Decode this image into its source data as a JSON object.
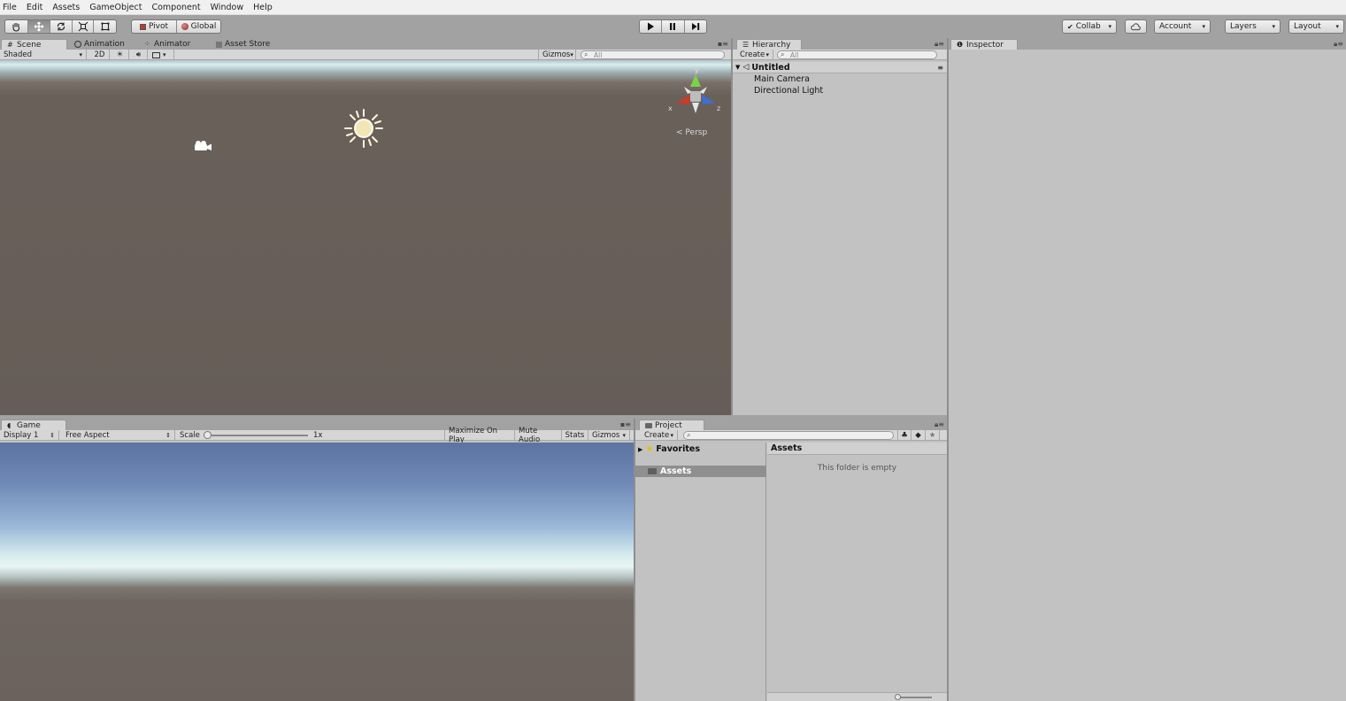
{
  "menu": [
    "File",
    "Edit",
    "Assets",
    "GameObject",
    "Component",
    "Window",
    "Help"
  ],
  "toolbar": {
    "tools": [
      {
        "name": "hand-tool",
        "active": false
      },
      {
        "name": "move-tool",
        "active": true
      },
      {
        "name": "rotate-tool",
        "active": false
      },
      {
        "name": "scale-tool",
        "active": false
      },
      {
        "name": "rect-tool",
        "active": false
      }
    ],
    "pivot_label": "Pivot",
    "global_label": "Global",
    "collab_label": "Collab",
    "account_label": "Account",
    "layers_label": "Layers",
    "layout_label": "Layout"
  },
  "scene": {
    "tabs": [
      "Scene",
      "Animation",
      "Animator",
      "Asset Store"
    ],
    "shading_mode": "Shaded",
    "mode_2d_label": "2D",
    "gizmos_label": "Gizmos",
    "search_placeholder": "All",
    "persp_label": "Persp",
    "axis_x": "x",
    "axis_y": "y",
    "axis_z": "z"
  },
  "hierarchy": {
    "tab_label": "Hierarchy",
    "create_label": "Create",
    "search_placeholder": "All",
    "scene_name": "Untitled",
    "items": [
      "Main Camera",
      "Directional Light"
    ]
  },
  "inspector": {
    "tab_label": "Inspector"
  },
  "game": {
    "tab_label": "Game",
    "display_label": "Display 1",
    "aspect_label": "Free Aspect",
    "scale_label": "Scale",
    "scale_value": "1x",
    "scale_fraction": 0.0,
    "buttons": [
      "Maximize On Play",
      "Mute Audio",
      "Stats",
      "Gizmos"
    ]
  },
  "project": {
    "tab_label": "Project",
    "create_label": "Create",
    "favorites_label": "Favorites",
    "assets_label": "Assets",
    "assets_header": "Assets",
    "empty_message": "This folder is empty"
  }
}
